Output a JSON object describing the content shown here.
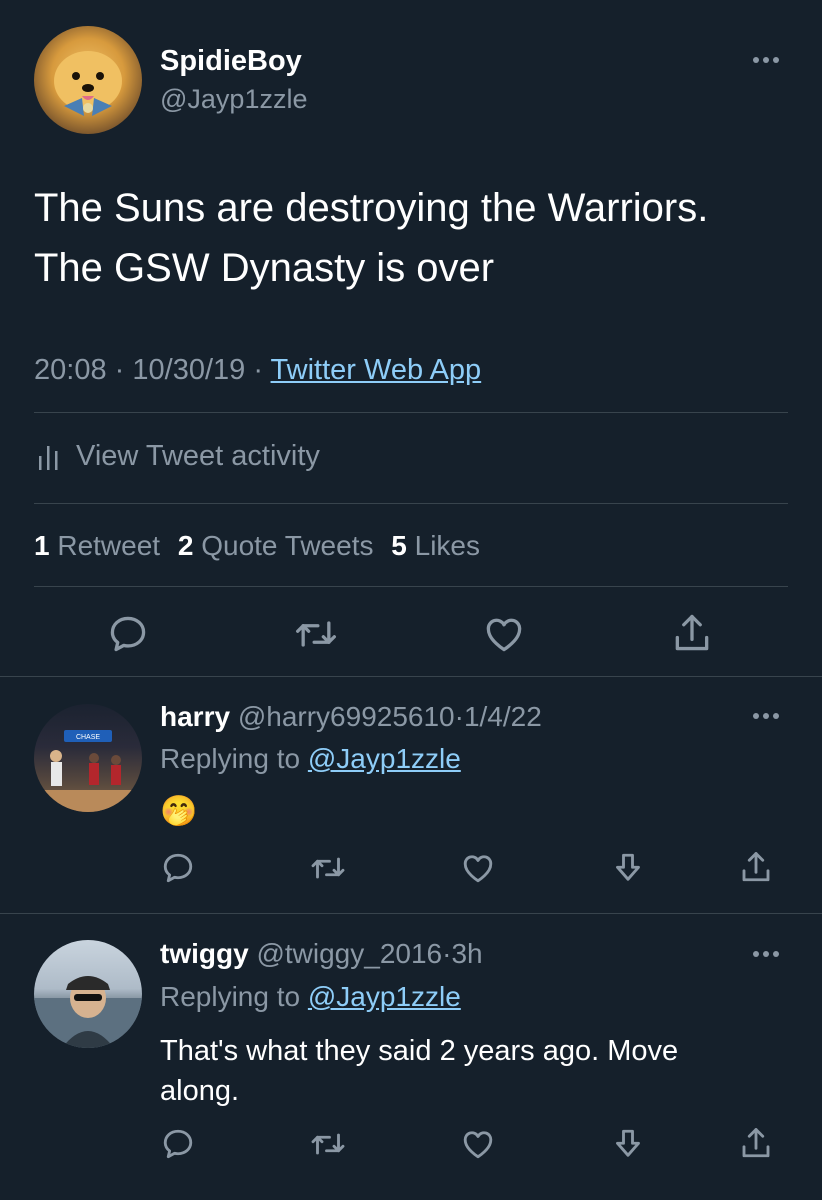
{
  "tweet": {
    "author_name": "SpidieBoy",
    "author_handle": "@Jayp1zzle",
    "text_line1": "The Suns are destroying the Warriors.",
    "text_line2": "The GSW Dynasty is over",
    "time": "20:08",
    "date": "10/30/19",
    "separator": "·",
    "source": "Twitter Web App",
    "activity_label": "View Tweet activity",
    "stats": {
      "retweets_count": "1",
      "retweets_label": "Retweet",
      "quotes_count": "2",
      "quotes_label": "Quote Tweets",
      "likes_count": "5",
      "likes_label": "Likes"
    },
    "actions": [
      "reply-icon",
      "retweet-icon",
      "like-icon",
      "share-icon"
    ]
  },
  "replies": [
    {
      "name": "harry",
      "handle": "@harry69925610",
      "separator": "·",
      "time": "1/4/22",
      "replying_prefix": "Replying to",
      "replying_to": "@Jayp1zzle",
      "text": "🤭"
    },
    {
      "name": "twiggy",
      "handle": "@twiggy_2016",
      "separator": "·",
      "time": "3h",
      "replying_prefix": "Replying to",
      "replying_to": "@Jayp1zzle",
      "text_line1": "That's what they said 2 years ago. Move",
      "text_line2": "along."
    }
  ],
  "colors": {
    "background": "#15202b",
    "text": "#ffffff",
    "muted": "#8b98a5",
    "link": "#8ecdf8",
    "divider": "#38444d"
  }
}
